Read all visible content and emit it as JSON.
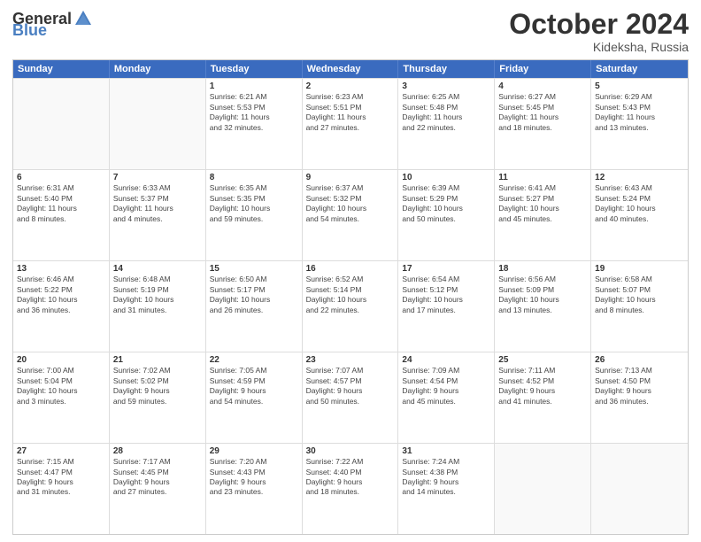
{
  "header": {
    "logo_general": "General",
    "logo_blue": "Blue",
    "month_title": "October 2024",
    "subtitle": "Kideksha, Russia"
  },
  "weekdays": [
    "Sunday",
    "Monday",
    "Tuesday",
    "Wednesday",
    "Thursday",
    "Friday",
    "Saturday"
  ],
  "rows": [
    [
      {
        "day": "",
        "info": ""
      },
      {
        "day": "",
        "info": ""
      },
      {
        "day": "1",
        "info": "Sunrise: 6:21 AM\nSunset: 5:53 PM\nDaylight: 11 hours\nand 32 minutes."
      },
      {
        "day": "2",
        "info": "Sunrise: 6:23 AM\nSunset: 5:51 PM\nDaylight: 11 hours\nand 27 minutes."
      },
      {
        "day": "3",
        "info": "Sunrise: 6:25 AM\nSunset: 5:48 PM\nDaylight: 11 hours\nand 22 minutes."
      },
      {
        "day": "4",
        "info": "Sunrise: 6:27 AM\nSunset: 5:45 PM\nDaylight: 11 hours\nand 18 minutes."
      },
      {
        "day": "5",
        "info": "Sunrise: 6:29 AM\nSunset: 5:43 PM\nDaylight: 11 hours\nand 13 minutes."
      }
    ],
    [
      {
        "day": "6",
        "info": "Sunrise: 6:31 AM\nSunset: 5:40 PM\nDaylight: 11 hours\nand 8 minutes."
      },
      {
        "day": "7",
        "info": "Sunrise: 6:33 AM\nSunset: 5:37 PM\nDaylight: 11 hours\nand 4 minutes."
      },
      {
        "day": "8",
        "info": "Sunrise: 6:35 AM\nSunset: 5:35 PM\nDaylight: 10 hours\nand 59 minutes."
      },
      {
        "day": "9",
        "info": "Sunrise: 6:37 AM\nSunset: 5:32 PM\nDaylight: 10 hours\nand 54 minutes."
      },
      {
        "day": "10",
        "info": "Sunrise: 6:39 AM\nSunset: 5:29 PM\nDaylight: 10 hours\nand 50 minutes."
      },
      {
        "day": "11",
        "info": "Sunrise: 6:41 AM\nSunset: 5:27 PM\nDaylight: 10 hours\nand 45 minutes."
      },
      {
        "day": "12",
        "info": "Sunrise: 6:43 AM\nSunset: 5:24 PM\nDaylight: 10 hours\nand 40 minutes."
      }
    ],
    [
      {
        "day": "13",
        "info": "Sunrise: 6:46 AM\nSunset: 5:22 PM\nDaylight: 10 hours\nand 36 minutes."
      },
      {
        "day": "14",
        "info": "Sunrise: 6:48 AM\nSunset: 5:19 PM\nDaylight: 10 hours\nand 31 minutes."
      },
      {
        "day": "15",
        "info": "Sunrise: 6:50 AM\nSunset: 5:17 PM\nDaylight: 10 hours\nand 26 minutes."
      },
      {
        "day": "16",
        "info": "Sunrise: 6:52 AM\nSunset: 5:14 PM\nDaylight: 10 hours\nand 22 minutes."
      },
      {
        "day": "17",
        "info": "Sunrise: 6:54 AM\nSunset: 5:12 PM\nDaylight: 10 hours\nand 17 minutes."
      },
      {
        "day": "18",
        "info": "Sunrise: 6:56 AM\nSunset: 5:09 PM\nDaylight: 10 hours\nand 13 minutes."
      },
      {
        "day": "19",
        "info": "Sunrise: 6:58 AM\nSunset: 5:07 PM\nDaylight: 10 hours\nand 8 minutes."
      }
    ],
    [
      {
        "day": "20",
        "info": "Sunrise: 7:00 AM\nSunset: 5:04 PM\nDaylight: 10 hours\nand 3 minutes."
      },
      {
        "day": "21",
        "info": "Sunrise: 7:02 AM\nSunset: 5:02 PM\nDaylight: 9 hours\nand 59 minutes."
      },
      {
        "day": "22",
        "info": "Sunrise: 7:05 AM\nSunset: 4:59 PM\nDaylight: 9 hours\nand 54 minutes."
      },
      {
        "day": "23",
        "info": "Sunrise: 7:07 AM\nSunset: 4:57 PM\nDaylight: 9 hours\nand 50 minutes."
      },
      {
        "day": "24",
        "info": "Sunrise: 7:09 AM\nSunset: 4:54 PM\nDaylight: 9 hours\nand 45 minutes."
      },
      {
        "day": "25",
        "info": "Sunrise: 7:11 AM\nSunset: 4:52 PM\nDaylight: 9 hours\nand 41 minutes."
      },
      {
        "day": "26",
        "info": "Sunrise: 7:13 AM\nSunset: 4:50 PM\nDaylight: 9 hours\nand 36 minutes."
      }
    ],
    [
      {
        "day": "27",
        "info": "Sunrise: 7:15 AM\nSunset: 4:47 PM\nDaylight: 9 hours\nand 31 minutes."
      },
      {
        "day": "28",
        "info": "Sunrise: 7:17 AM\nSunset: 4:45 PM\nDaylight: 9 hours\nand 27 minutes."
      },
      {
        "day": "29",
        "info": "Sunrise: 7:20 AM\nSunset: 4:43 PM\nDaylight: 9 hours\nand 23 minutes."
      },
      {
        "day": "30",
        "info": "Sunrise: 7:22 AM\nSunset: 4:40 PM\nDaylight: 9 hours\nand 18 minutes."
      },
      {
        "day": "31",
        "info": "Sunrise: 7:24 AM\nSunset: 4:38 PM\nDaylight: 9 hours\nand 14 minutes."
      },
      {
        "day": "",
        "info": ""
      },
      {
        "day": "",
        "info": ""
      }
    ]
  ]
}
